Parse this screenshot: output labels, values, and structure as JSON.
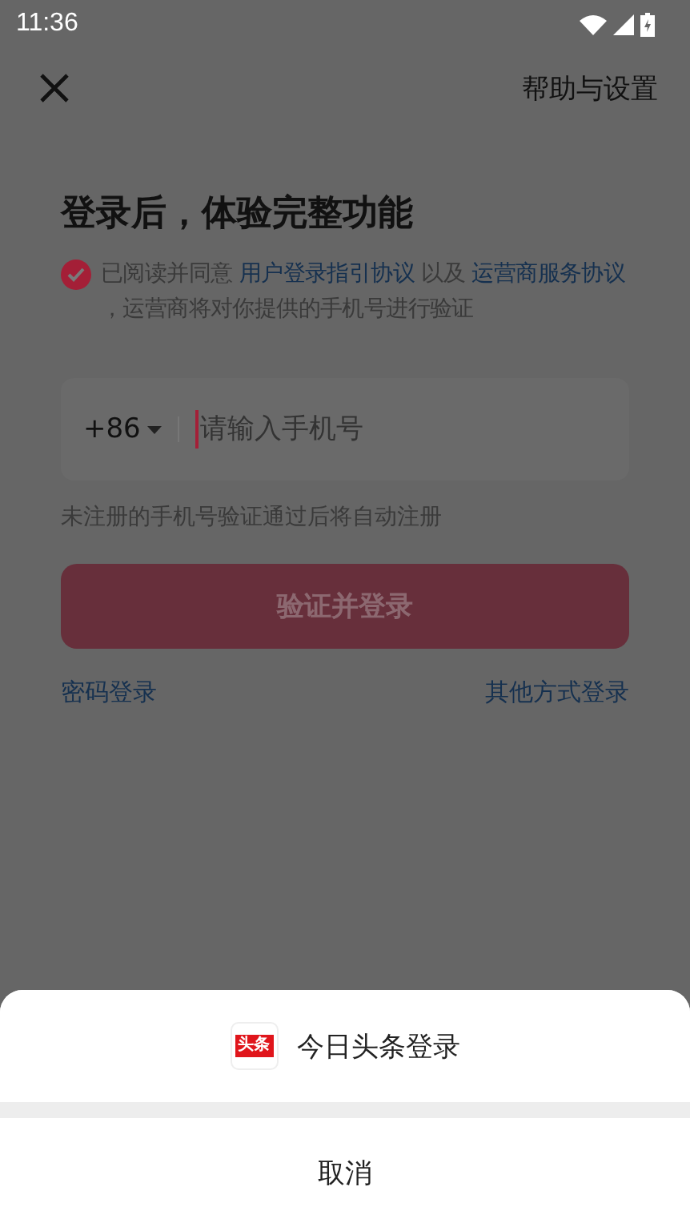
{
  "status_bar": {
    "time": "11:36"
  },
  "nav": {
    "action": "帮助与设置"
  },
  "title": "登录后，体验完整功能",
  "agreement": {
    "checked": true,
    "prefix": "已阅读并同意",
    "link_1": "用户登录指引协议",
    "middle": "以及",
    "link_2": "运营商服务协议",
    "suffix": "，运营商将对你提供的手机号进行验证"
  },
  "phone_field": {
    "country_code": "+86",
    "placeholder": "请输入手机号"
  },
  "hint": "未注册的手机号验证通过后将自动注册",
  "submit_button": {
    "label": "验证并登录",
    "disabled": true
  },
  "links": {
    "left": "密码登录",
    "right": "其他方式登录"
  },
  "sheet": {
    "options": [
      {
        "logo_text": "头条",
        "label": "今日头条登录"
      }
    ],
    "cancel": "取消"
  }
}
